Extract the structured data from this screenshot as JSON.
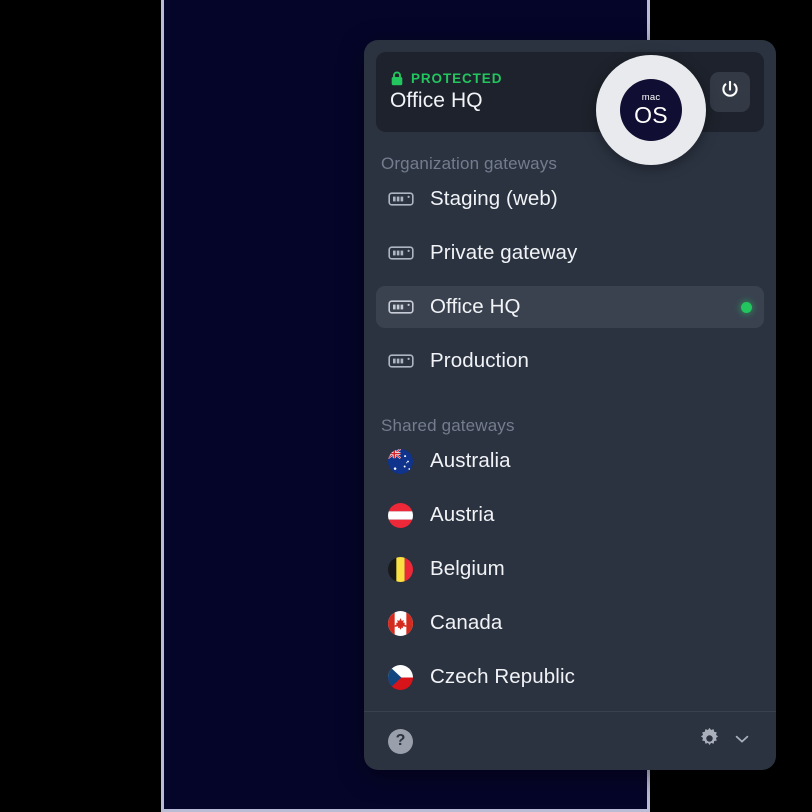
{
  "window": {
    "platform_badge": {
      "line1": "mac",
      "line2": "OS"
    }
  },
  "header": {
    "status_label": "PROTECTED",
    "connection_name": "Office HQ",
    "lock_icon": "lock-icon",
    "power_icon": "power-icon",
    "status_color": "#22c55e"
  },
  "sections": [
    {
      "title": "Organization gateways",
      "items": [
        {
          "label": "Staging (web)",
          "icon": "server-icon",
          "selected": false,
          "connected": false
        },
        {
          "label": "Private gateway",
          "icon": "server-icon",
          "selected": false,
          "connected": false
        },
        {
          "label": "Office HQ",
          "icon": "server-icon",
          "selected": true,
          "connected": true
        },
        {
          "label": "Production",
          "icon": "server-icon",
          "selected": false,
          "connected": false
        }
      ]
    },
    {
      "title": "Shared gateways",
      "items": [
        {
          "label": "Australia",
          "icon": "flag-australia",
          "selected": false,
          "connected": false
        },
        {
          "label": "Austria",
          "icon": "flag-austria",
          "selected": false,
          "connected": false
        },
        {
          "label": "Belgium",
          "icon": "flag-belgium",
          "selected": false,
          "connected": false
        },
        {
          "label": "Canada",
          "icon": "flag-canada",
          "selected": false,
          "connected": false
        },
        {
          "label": "Czech Republic",
          "icon": "flag-czech-republic",
          "selected": false,
          "connected": false
        }
      ]
    }
  ],
  "footer": {
    "help_label": "?",
    "help_icon": "question-mark-icon",
    "settings_icon": "gear-icon",
    "expand_icon": "chevron-down-icon"
  },
  "colors": {
    "accent_green": "#22c55e",
    "card_background": "#2b3341",
    "header_background": "#1d222c",
    "selected_row": "#3a4250",
    "panel_background": "#05052a",
    "muted_text": "#737d8d"
  }
}
